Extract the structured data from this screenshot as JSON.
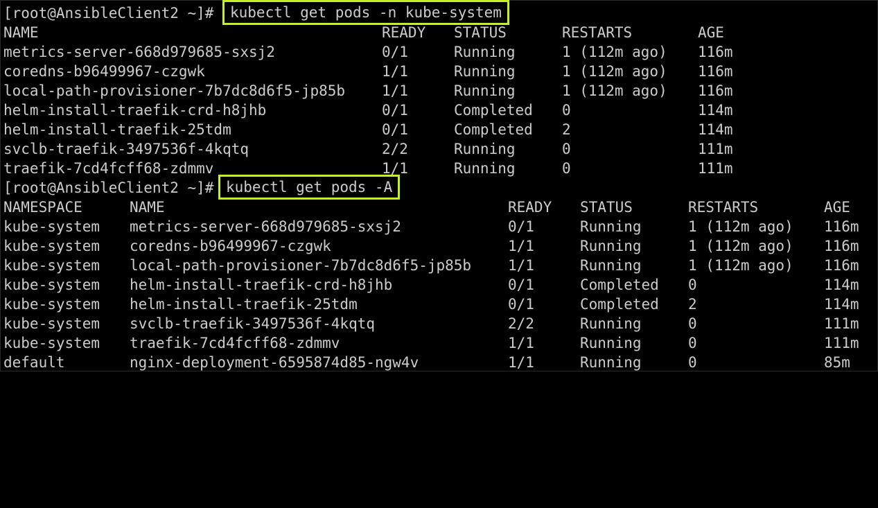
{
  "session1": {
    "prompt": "[root@AnsibleClient2 ~]#",
    "command": "kubectl get pods -n kube-system",
    "headers": {
      "name": "NAME",
      "ready": "READY",
      "status": "STATUS",
      "restarts": "RESTARTS",
      "age": "AGE"
    },
    "rows": [
      {
        "name": "metrics-server-668d979685-sxsj2",
        "ready": "0/1",
        "status": "Running",
        "restarts": "1 (112m ago)",
        "age": "116m"
      },
      {
        "name": "coredns-b96499967-czgwk",
        "ready": "1/1",
        "status": "Running",
        "restarts": "1 (112m ago)",
        "age": "116m"
      },
      {
        "name": "local-path-provisioner-7b7dc8d6f5-jp85b",
        "ready": "1/1",
        "status": "Running",
        "restarts": "1 (112m ago)",
        "age": "116m"
      },
      {
        "name": "helm-install-traefik-crd-h8jhb",
        "ready": "0/1",
        "status": "Completed",
        "restarts": "0",
        "age": "114m"
      },
      {
        "name": "helm-install-traefik-25tdm",
        "ready": "0/1",
        "status": "Completed",
        "restarts": "2",
        "age": "114m"
      },
      {
        "name": "svclb-traefik-3497536f-4kqtq",
        "ready": "2/2",
        "status": "Running",
        "restarts": "0",
        "age": "111m"
      },
      {
        "name": "traefik-7cd4fcff68-zdmmv",
        "ready": "1/1",
        "status": "Running",
        "restarts": "0",
        "age": "111m"
      }
    ]
  },
  "session2": {
    "prompt": "[root@AnsibleClient2 ~]#",
    "command": "kubectl get pods -A",
    "headers": {
      "namespace": "NAMESPACE",
      "name": "NAME",
      "ready": "READY",
      "status": "STATUS",
      "restarts": "RESTARTS",
      "age": "AGE"
    },
    "rows": [
      {
        "namespace": "kube-system",
        "name": "metrics-server-668d979685-sxsj2",
        "ready": "0/1",
        "status": "Running",
        "restarts": "1 (112m ago)",
        "age": "116m"
      },
      {
        "namespace": "kube-system",
        "name": "coredns-b96499967-czgwk",
        "ready": "1/1",
        "status": "Running",
        "restarts": "1 (112m ago)",
        "age": "116m"
      },
      {
        "namespace": "kube-system",
        "name": "local-path-provisioner-7b7dc8d6f5-jp85b",
        "ready": "1/1",
        "status": "Running",
        "restarts": "1 (112m ago)",
        "age": "116m"
      },
      {
        "namespace": "kube-system",
        "name": "helm-install-traefik-crd-h8jhb",
        "ready": "0/1",
        "status": "Completed",
        "restarts": "0",
        "age": "114m"
      },
      {
        "namespace": "kube-system",
        "name": "helm-install-traefik-25tdm",
        "ready": "0/1",
        "status": "Completed",
        "restarts": "2",
        "age": "114m"
      },
      {
        "namespace": "kube-system",
        "name": "svclb-traefik-3497536f-4kqtq",
        "ready": "2/2",
        "status": "Running",
        "restarts": "0",
        "age": "111m"
      },
      {
        "namespace": "kube-system",
        "name": "traefik-7cd4fcff68-zdmmv",
        "ready": "1/1",
        "status": "Running",
        "restarts": "0",
        "age": "111m"
      },
      {
        "namespace": "default",
        "name": "nginx-deployment-6595874d85-ngw4v",
        "ready": "1/1",
        "status": "Running",
        "restarts": "0",
        "age": "85m"
      }
    ]
  },
  "colors": {
    "background": "#000000",
    "text": "#cccccc",
    "highlight_box": "#c6f21a"
  }
}
